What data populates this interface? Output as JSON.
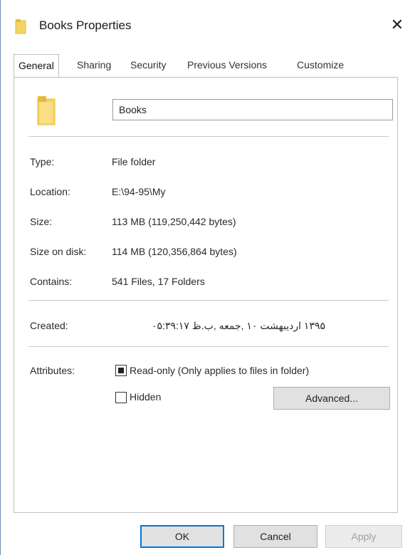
{
  "window": {
    "title": "Books Properties",
    "close_glyph": "✕"
  },
  "tabs": [
    {
      "label": "General",
      "active": true
    },
    {
      "label": "Sharing",
      "active": false
    },
    {
      "label": "Security",
      "active": false
    },
    {
      "label": "Previous Versions",
      "active": false
    },
    {
      "label": "Customize",
      "active": false
    }
  ],
  "general": {
    "folder_name": "Books",
    "type_label": "Type:",
    "type_value": "File folder",
    "location_label": "Location:",
    "location_value": "E:\\94-95\\My",
    "size_label": "Size:",
    "size_value": "113 MB (119,250,442 bytes)",
    "size_on_disk_label": "Size on disk:",
    "size_on_disk_value": "114 MB (120,356,864 bytes)",
    "contains_label": "Contains:",
    "contains_value": "541 Files, 17 Folders",
    "created_label": "Created:",
    "created_value": "۱۳۹۵ اردیبهشت ۱۰ ,جمعه ,ب.ظ ۰۵:۳۹:۱۷",
    "attributes_label": "Attributes:",
    "readonly_label": "Read-only (Only applies to files in folder)",
    "readonly_state": "indeterminate",
    "hidden_label": "Hidden",
    "hidden_state": "unchecked",
    "advanced_button": "Advanced..."
  },
  "footer": {
    "ok": "OK",
    "cancel": "Cancel",
    "apply": "Apply"
  },
  "colors": {
    "folder": "#f6d365",
    "folder_dark": "#e6b93d",
    "accent": "#0078d7"
  },
  "icons": {
    "title": "folder-icon",
    "close": "close-icon"
  }
}
